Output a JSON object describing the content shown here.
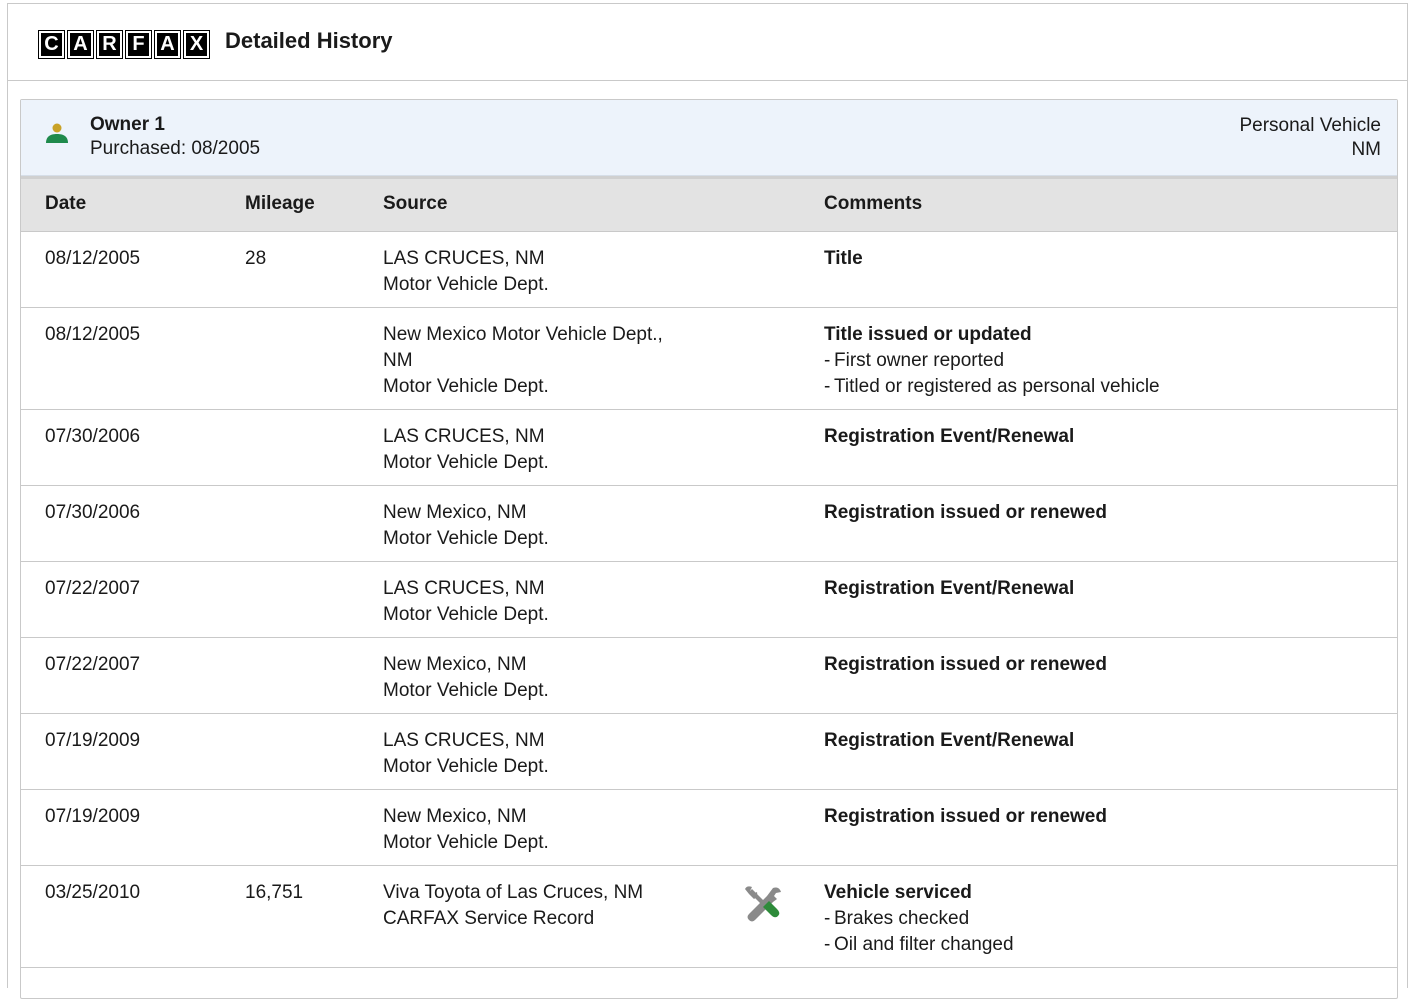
{
  "header": {
    "logo_letters": [
      "C",
      "A",
      "R",
      "F",
      "A",
      "X"
    ],
    "title": "Detailed History"
  },
  "owner": {
    "name": "Owner 1",
    "purchased": "Purchased: 08/2005",
    "usage": "Personal Vehicle",
    "state": "NM",
    "icon": "person-icon",
    "icon_colors": {
      "head": "#c9a227",
      "body": "#1f8a4c"
    }
  },
  "table": {
    "columns": [
      "Date",
      "Mileage",
      "Source",
      "Comments"
    ],
    "rows": [
      {
        "date": "08/12/2005",
        "mileage": "28",
        "source": [
          "LAS CRUCES, NM",
          "Motor Vehicle Dept."
        ],
        "icon": "",
        "comment_title": "Title",
        "comment_details": []
      },
      {
        "date": "08/12/2005",
        "mileage": "",
        "source": [
          "New Mexico Motor Vehicle Dept.,",
          "NM",
          "Motor Vehicle Dept."
        ],
        "icon": "",
        "comment_title": "Title issued or updated",
        "comment_details": [
          "First owner reported",
          "Titled or registered as personal vehicle"
        ]
      },
      {
        "date": "07/30/2006",
        "mileage": "",
        "source": [
          "LAS CRUCES, NM",
          "Motor Vehicle Dept."
        ],
        "icon": "",
        "comment_title": "Registration Event/Renewal",
        "comment_details": []
      },
      {
        "date": "07/30/2006",
        "mileage": "",
        "source": [
          "New Mexico, NM",
          "Motor Vehicle Dept."
        ],
        "icon": "",
        "comment_title": "Registration issued or renewed",
        "comment_details": []
      },
      {
        "date": "07/22/2007",
        "mileage": "",
        "source": [
          "LAS CRUCES, NM",
          "Motor Vehicle Dept."
        ],
        "icon": "",
        "comment_title": "Registration Event/Renewal",
        "comment_details": []
      },
      {
        "date": "07/22/2007",
        "mileage": "",
        "source": [
          "New Mexico, NM",
          "Motor Vehicle Dept."
        ],
        "icon": "",
        "comment_title": "Registration issued or renewed",
        "comment_details": []
      },
      {
        "date": "07/19/2009",
        "mileage": "",
        "source": [
          "LAS CRUCES, NM",
          "Motor Vehicle Dept."
        ],
        "icon": "",
        "comment_title": "Registration Event/Renewal",
        "comment_details": []
      },
      {
        "date": "07/19/2009",
        "mileage": "",
        "source": [
          "New Mexico, NM",
          "Motor Vehicle Dept."
        ],
        "icon": "",
        "comment_title": "Registration issued or renewed",
        "comment_details": []
      },
      {
        "date": "03/25/2010",
        "mileage": "16,751",
        "source": [
          "Viva Toyota of Las Cruces, NM",
          "CARFAX Service Record"
        ],
        "icon": "service-tools-icon",
        "comment_title": "Vehicle serviced",
        "comment_details": [
          "Brakes checked",
          "Oil and filter changed"
        ]
      }
    ]
  },
  "colors": {
    "owner_bar": "#edf3fb",
    "table_header": "#e3e3e3",
    "border": "#c9c9c9",
    "tool_gray": "#8a8a8a",
    "tool_green": "#2e8b3a"
  }
}
